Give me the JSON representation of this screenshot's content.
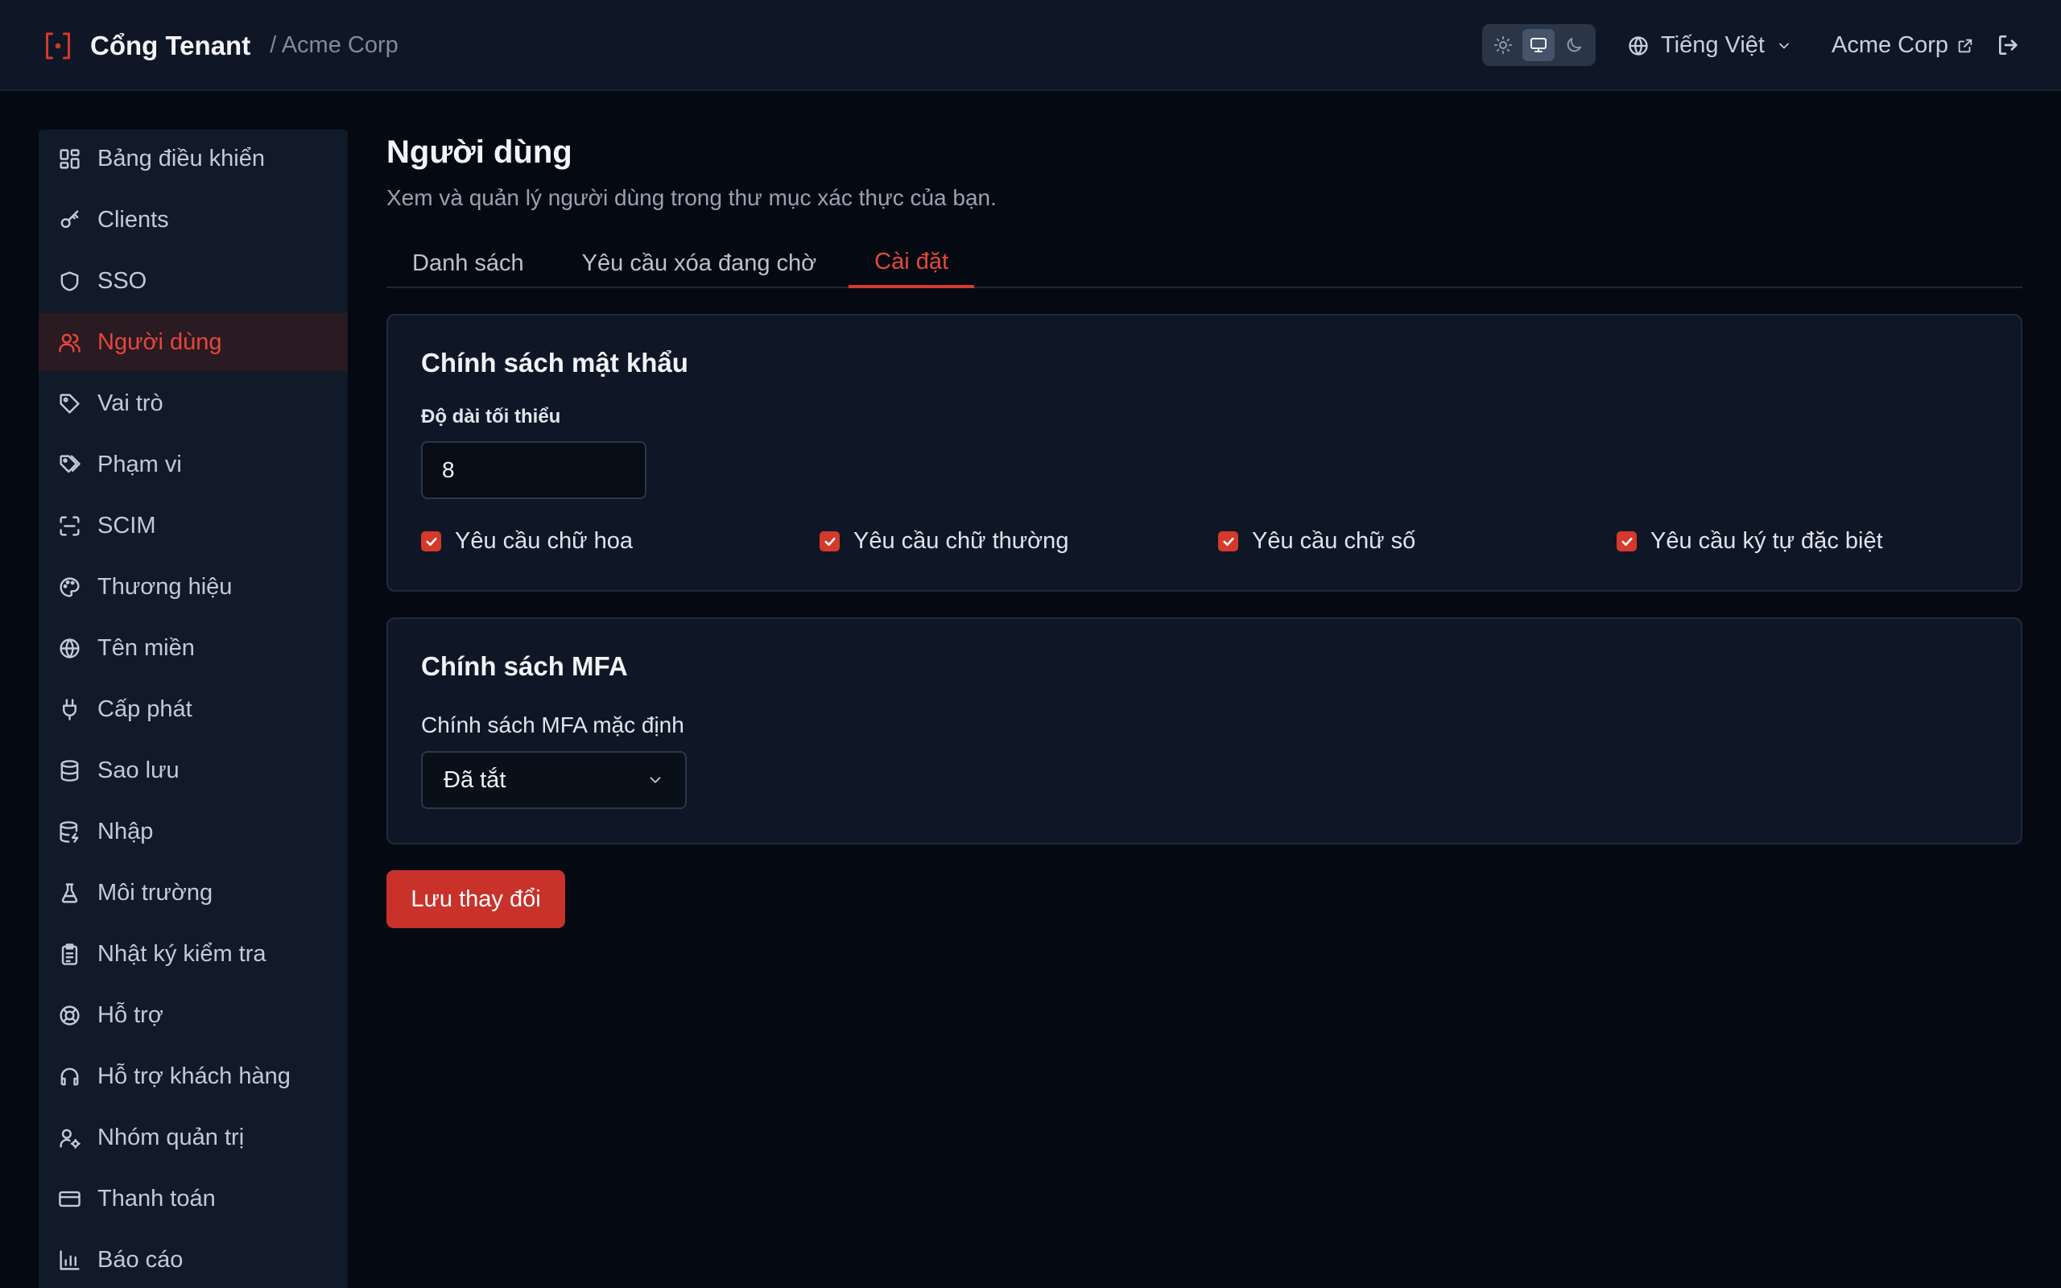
{
  "header": {
    "app_name": "Cổng Tenant",
    "org_crumb": "/ Acme Corp",
    "theme_options": [
      "light-icon",
      "monitor-icon",
      "moon-icon"
    ],
    "theme_active": "monitor-icon",
    "language": "Tiếng Việt",
    "org_name": "Acme Corp"
  },
  "sidebar": {
    "items": [
      {
        "label": "Bảng điều khiển",
        "icon": "dashboard-icon"
      },
      {
        "label": "Clients",
        "icon": "key-icon"
      },
      {
        "label": "SSO",
        "icon": "shield-icon"
      },
      {
        "label": "Người dùng",
        "icon": "users-icon",
        "active": true
      },
      {
        "label": "Vai trò",
        "icon": "tag-icon"
      },
      {
        "label": "Phạm vi",
        "icon": "tags-icon"
      },
      {
        "label": "SCIM",
        "icon": "scan-icon"
      },
      {
        "label": "Thương hiệu",
        "icon": "palette-icon"
      },
      {
        "label": "Tên miền",
        "icon": "globe-icon"
      },
      {
        "label": "Cấp phát",
        "icon": "plug-icon"
      },
      {
        "label": "Sao lưu",
        "icon": "database-icon"
      },
      {
        "label": "Nhập",
        "icon": "database-import-icon"
      },
      {
        "label": "Môi trường",
        "icon": "flask-icon"
      },
      {
        "label": "Nhật ký kiểm tra",
        "icon": "clipboard-icon"
      },
      {
        "label": "Hỗ trợ",
        "icon": "lifebuoy-icon"
      },
      {
        "label": "Hỗ trợ khách hàng",
        "icon": "headset-icon"
      },
      {
        "label": "Nhóm quản trị",
        "icon": "user-cog-icon"
      },
      {
        "label": "Thanh toán",
        "icon": "credit-card-icon"
      },
      {
        "label": "Báo cáo",
        "icon": "bar-chart-icon"
      }
    ]
  },
  "main": {
    "title": "Người dùng",
    "subtitle": "Xem và quản lý người dùng trong thư mục xác thực của bạn.",
    "tabs": [
      {
        "label": "Danh sách"
      },
      {
        "label": "Yêu cầu xóa đang chờ"
      },
      {
        "label": "Cài đặt",
        "active": true
      }
    ],
    "password_policy": {
      "title": "Chính sách mật khẩu",
      "min_length_label": "Độ dài tối thiểu",
      "min_length_value": "8",
      "checks": [
        {
          "label": "Yêu cầu chữ hoa",
          "checked": true
        },
        {
          "label": "Yêu cầu chữ thường",
          "checked": true
        },
        {
          "label": "Yêu cầu chữ số",
          "checked": true
        },
        {
          "label": "Yêu cầu ký tự đặc biệt",
          "checked": true
        }
      ]
    },
    "mfa_policy": {
      "title": "Chính sách MFA",
      "default_label": "Chính sách MFA mặc định",
      "default_value": "Đã tắt"
    },
    "save_label": "Lưu thay đổi"
  },
  "colors": {
    "accent": "#d4392c",
    "background": "#050a12",
    "panel": "#0f1726"
  }
}
